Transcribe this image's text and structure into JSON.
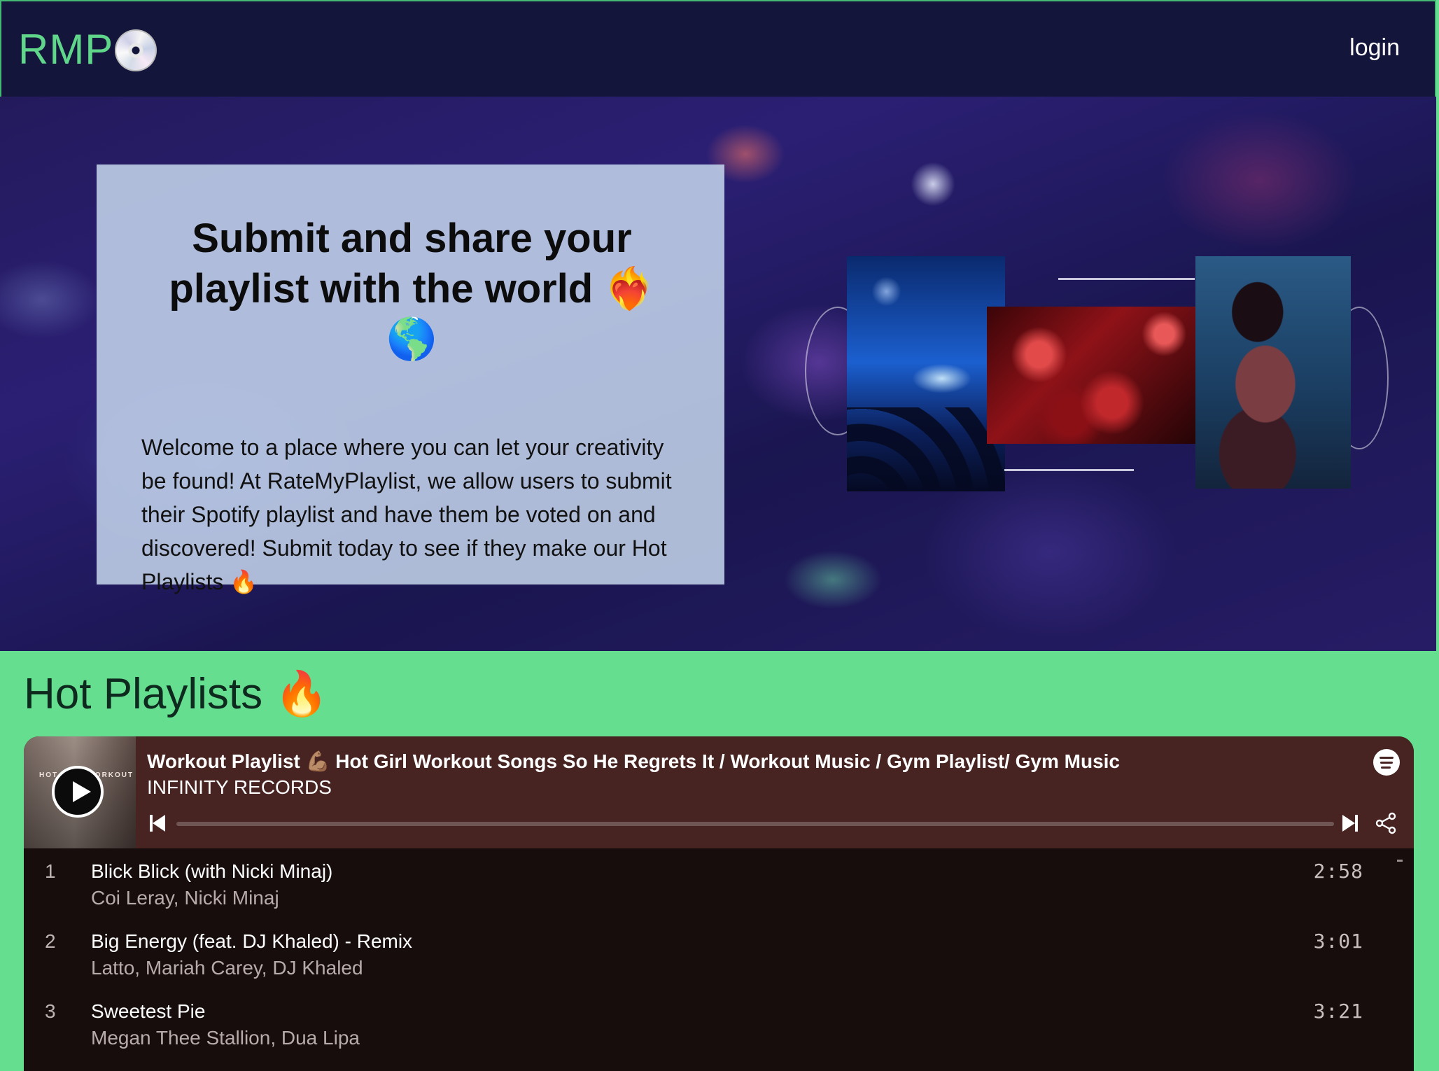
{
  "nav": {
    "logo_text": "RMP",
    "logo_icon": "cd-disc-icon",
    "login_label": "login"
  },
  "hero": {
    "title": "Submit and share your playlist with the world ❤️‍🔥 🌎",
    "text": "Welcome to a place where you can let your creativity be found! At RateMyPlaylist, we allow users to submit their Spotify playlist and have them be voted on and discovered! Submit today to see if they make our Hot Playlists 🔥"
  },
  "hot": {
    "title": "Hot Playlists 🔥"
  },
  "player": {
    "cover_text": "HOT GIRL WORKOUT",
    "title": "Workout Playlist 💪🏽 Hot Girl Workout Songs So He Regrets It / Workout Music / Gym Playlist/ Gym Music",
    "owner": "INFINITY RECORDS",
    "progress": 0,
    "tracks": [
      {
        "num": "1",
        "name": "Blick Blick (with Nicki Minaj)",
        "artist": "Coi Leray, Nicki Minaj",
        "duration": "2:58"
      },
      {
        "num": "2",
        "name": "Big Energy (feat. DJ Khaled) - Remix",
        "artist": "Latto, Mariah Carey, DJ Khaled",
        "duration": "3:01"
      },
      {
        "num": "3",
        "name": "Sweetest Pie",
        "artist": "Megan Thee Stallion, Dua Lipa",
        "duration": "3:21"
      }
    ]
  },
  "colors": {
    "nav_bg": "#14153a",
    "brand_green": "#5fd68a",
    "page_green": "#66de8f",
    "player_head": "#472422",
    "player_body": "#180d0d"
  }
}
